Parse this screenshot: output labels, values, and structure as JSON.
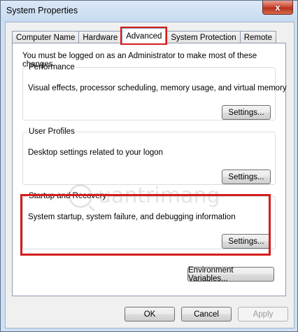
{
  "window": {
    "title": "System Properties",
    "close_glyph": "x"
  },
  "tabs": [
    {
      "label": "Computer Name",
      "active": false
    },
    {
      "label": "Hardware",
      "active": false
    },
    {
      "label": "Advanced",
      "active": true
    },
    {
      "label": "System Protection",
      "active": false
    },
    {
      "label": "Remote",
      "active": false
    }
  ],
  "advanced": {
    "notice": "You must be logged on as an Administrator to make most of these changes.",
    "performance": {
      "title": "Performance",
      "description": "Visual effects, processor scheduling, memory usage, and virtual memory",
      "button": "Settings..."
    },
    "user_profiles": {
      "title": "User Profiles",
      "description": "Desktop settings related to your logon",
      "button": "Settings..."
    },
    "startup_recovery": {
      "title": "Startup and Recovery",
      "description": "System startup, system failure, and debugging information",
      "button": "Settings..."
    },
    "env_button": "Environment Variables..."
  },
  "footer": {
    "ok": "OK",
    "cancel": "Cancel",
    "apply": "Apply"
  },
  "watermark": "uantrimang",
  "colors": {
    "highlight": "#d51c1c",
    "titlebar": "#cfe0f2",
    "close_button": "#c8452f"
  }
}
